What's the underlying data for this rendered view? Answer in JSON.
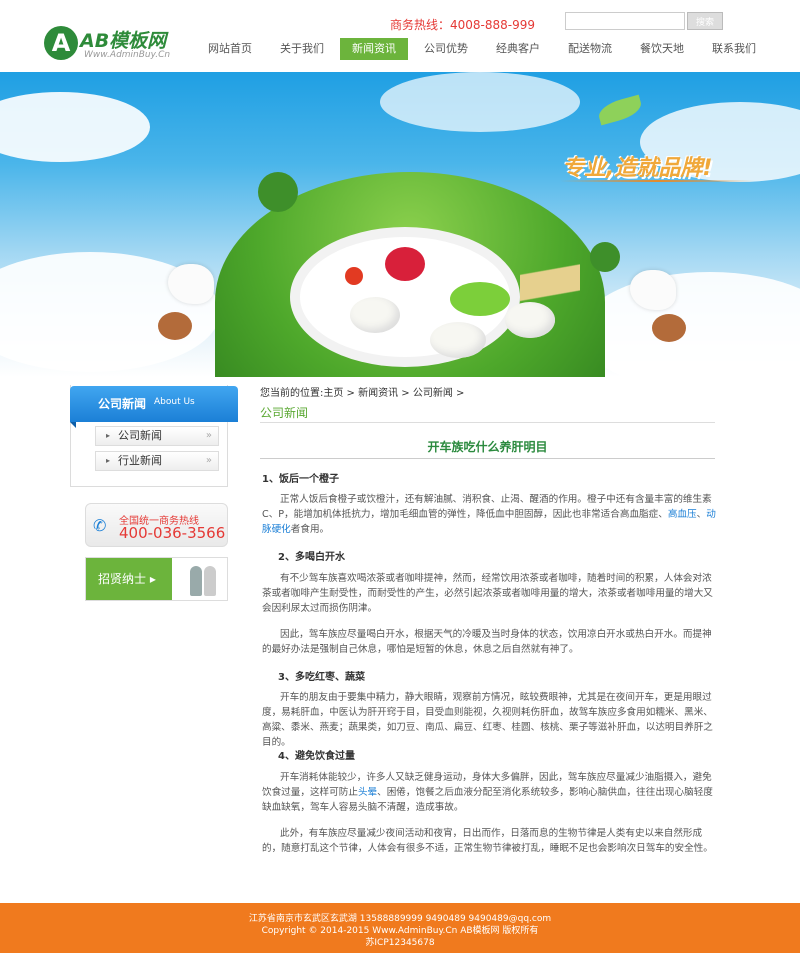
{
  "header": {
    "logo_text": "AB模板网",
    "logo_mark": "A",
    "logo_url": "Www.AdminBuy.Cn",
    "hotline": "商务热线：4008-888-999",
    "search_placeholder": "",
    "search_button": "搜索"
  },
  "nav": {
    "items": [
      "网站首页",
      "关于我们",
      "新闻资讯",
      "公司优势",
      "经典客户",
      "配送物流",
      "餐饮天地",
      "联系我们"
    ],
    "active": "新闻资讯"
  },
  "banner": {
    "slogan": "专业,造就品牌!"
  },
  "sidebar": {
    "title": "公司新闻",
    "title_en": "About Us",
    "items": [
      "公司新闻",
      "行业新闻"
    ],
    "hotline_label": "全国统一商务热线",
    "hotline_number": "400-036-3566",
    "recruit_label": "招贤纳士"
  },
  "main": {
    "breadcrumb": "您当前的位置:主页 > 新闻资讯 > 公司新闻 >",
    "section_title": "公司新闻",
    "article_title": "开车族吃什么养肝明目",
    "h1": "1、饭后一个橙子",
    "p1_a": "正常人饭后食橙子或饮橙汁，还有解油腻、消积食、止渴、醒酒的作用。橙子中还有含量丰富的维生素C、P，能增加机体抵抗力，增加毛细血管的弹性，降低血中胆固醇，因此也非常适合高血脂症、",
    "p1_link1": "高血压",
    "p1_sep": "、",
    "p1_link2": "动脉硬化",
    "p1_b": "者食用。",
    "h2": "2、多喝白开水",
    "p2": "有不少驾车族喜欢喝浓茶或者咖啡提神，然而，经常饮用浓茶或者咖啡，随着时间的积累，人体会对浓茶或者咖啡产生耐受性，而耐受性的产生，必然引起浓茶或者咖啡用量的增大，浓茶或者咖啡用量的增大又会因利尿太过而损伤阴津。",
    "p3": "因此，驾车族应尽量喝白开水，根据天气的冷暖及当时身体的状态，饮用凉白开水或热白开水。而提神的最好办法是强制自己休息，哪怕是短暂的休息，休息之后自然就有神了。",
    "h3": "3、多吃红枣、蔬菜",
    "p4": "开车的朋友由于要集中精力，静大眼睛，观察前方情况，眩较费眼神，尤其是在夜间开车，更是用眼过度，易耗肝血，中医认为肝开窍于目，目受血则能视，久视则耗伤肝血，故驾车族应多食用如糯米、黑米、高粱、黍米、燕麦；蔬果类，如刀豆、南瓜、扁豆、红枣、桂圆、核桃、栗子等滋补肝血，以达明目养肝之目的。",
    "h4": "4、避免饮食过量",
    "p5_a": "开车消耗体能较少，许多人又缺乏健身运动，身体大多偏胖，因此，驾车族应尽量减少油脂摄入，避免饮食过量，这样可防止",
    "p5_link": "头晕",
    "p5_b": "、困倦，饱餐之后血液分配至消化系统较多，影响心脑供血，往往出现心脑轻度缺血缺氧，驾车人容易头脑不清醒，造成事故。",
    "p6": "此外，有车族应尽量减少夜间活动和夜宵，日出而作，日落而息的生物节律是人类有史以来自然形成的，随意打乱这个节律，人体会有很多不适，正常生物节律被打乱，睡眠不足也会影响次日驾车的安全性。"
  },
  "footer": {
    "line1": "江苏省南京市玄武区玄武湖 13588889999 9490489 9490489@qq.com",
    "line2": "Copyright © 2014-2015 Www.AdminBuy.Cn AB模板网 版权所有",
    "line3": "苏ICP12345678"
  }
}
